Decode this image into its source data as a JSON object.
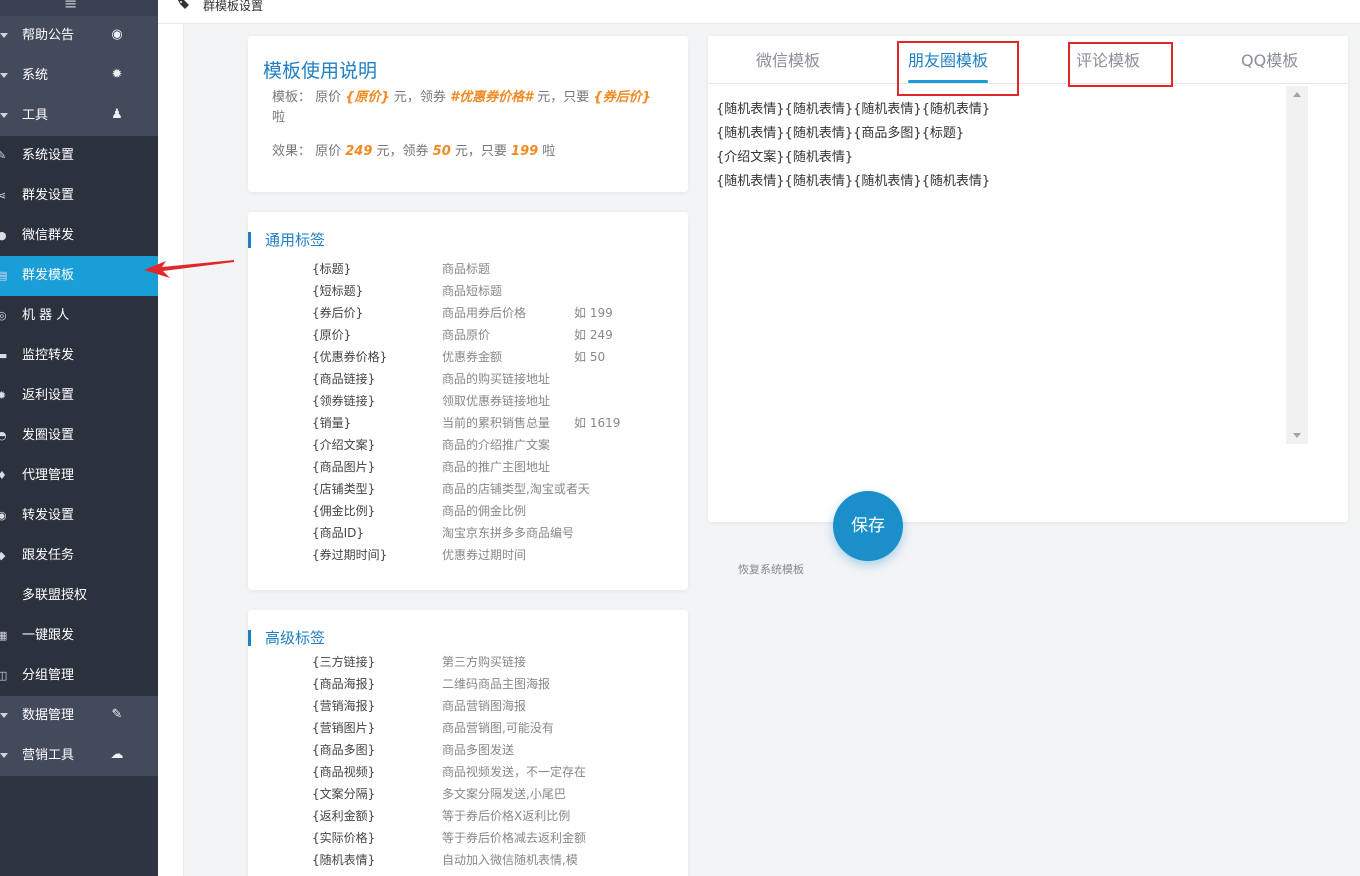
{
  "breadcrumb": {
    "title": "群模板设置"
  },
  "sidebar": {
    "items": [
      {
        "label": "帮助公告",
        "type": "header",
        "icon": "dashboard-icon"
      },
      {
        "label": "系统",
        "type": "header",
        "icon": "gear-icon"
      },
      {
        "label": "工具",
        "type": "header",
        "icon": "android-icon"
      },
      {
        "label": "系统设置",
        "type": "sub"
      },
      {
        "label": "群发设置",
        "type": "sub"
      },
      {
        "label": "微信群发",
        "type": "sub"
      },
      {
        "label": "群发模板",
        "type": "active"
      },
      {
        "label": "机 器 人",
        "type": "sub"
      },
      {
        "label": "监控转发",
        "type": "sub"
      },
      {
        "label": "返利设置",
        "type": "sub"
      },
      {
        "label": "发圈设置",
        "type": "sub"
      },
      {
        "label": "代理管理",
        "type": "sub"
      },
      {
        "label": "转发设置",
        "type": "sub"
      },
      {
        "label": "跟发任务",
        "type": "sub"
      },
      {
        "label": "多联盟授权",
        "type": "sub"
      },
      {
        "label": "一键跟发",
        "type": "sub"
      },
      {
        "label": "分组管理",
        "type": "sub"
      },
      {
        "label": "数据管理",
        "type": "header",
        "icon": "edit-icon"
      },
      {
        "label": "营销工具",
        "type": "header",
        "icon": "cloud-icon"
      }
    ]
  },
  "usage": {
    "title": "模板使用说明",
    "template_prefix": "模板：  原价 ",
    "t_origin": "{原价}",
    "t_mid1": " 元，领券 ",
    "t_coupon": "#优惠券价格#",
    "t_mid2": " 元，只要 ",
    "t_after": "{券后价}",
    "t_suffix": "啦",
    "effect_prefix": "效果：  原价 ",
    "e_origin": "249",
    "e_mid1": " 元，领券 ",
    "e_coupon": "50",
    "e_mid2": " 元，只要 ",
    "e_after": "199",
    "e_suffix": " 啦"
  },
  "common_tags": {
    "title": "通用标签",
    "rows": [
      {
        "key": "{标题}",
        "desc": "商品标题",
        "example": ""
      },
      {
        "key": "{短标题}",
        "desc": "商品短标题",
        "example": ""
      },
      {
        "key": "{券后价}",
        "desc": "商品用券后价格",
        "example": "如 199"
      },
      {
        "key": "{原价}",
        "desc": "商品原价",
        "example": "如 249"
      },
      {
        "key": "{优惠券价格}",
        "desc": "优惠券金额",
        "example": "如 50"
      },
      {
        "key": "{商品链接}",
        "desc": "商品的购买链接地址",
        "example": ""
      },
      {
        "key": "{领券链接}",
        "desc": "领取优惠券链接地址",
        "example": ""
      },
      {
        "key": "{销量}",
        "desc": "当前的累积销售总量",
        "example": "如 1619"
      },
      {
        "key": "{介绍文案}",
        "desc": "商品的介绍推广文案",
        "example": ""
      },
      {
        "key": "{商品图片}",
        "desc": "商品的推广主图地址",
        "example": ""
      },
      {
        "key": "{店铺类型}",
        "desc": "商品的店铺类型,淘宝或者天",
        "example": ""
      },
      {
        "key": "{佣金比例}",
        "desc": "商品的佣金比例",
        "example": ""
      },
      {
        "key": "{商品ID}",
        "desc": "淘宝京东拼多多商品编号",
        "example": ""
      },
      {
        "key": "{券过期时间}",
        "desc": "优惠券过期时间",
        "example": ""
      }
    ]
  },
  "advanced_tags": {
    "title": "高级标签",
    "rows": [
      {
        "key": "{三方链接}",
        "desc": "第三方购买链接"
      },
      {
        "key": "{商品海报}",
        "desc": "二维码商品主图海报"
      },
      {
        "key": "{营销海报}",
        "desc": "商品营销图海报"
      },
      {
        "key": "{营销图片}",
        "desc": "商品营销图,可能没有"
      },
      {
        "key": "{商品多图}",
        "desc": "商品多图发送"
      },
      {
        "key": "{商品视频}",
        "desc": "商品视频发送，不一定存在"
      },
      {
        "key": "{文案分隔}",
        "desc": "多文案分隔发送,小尾巴"
      },
      {
        "key": "{返利金额}",
        "desc": "等于券后价格X返利比例"
      },
      {
        "key": "{实际价格}",
        "desc": "等于券后价格减去返利金额"
      },
      {
        "key": "{随机表情}",
        "desc": "自动加入微信随机表情,模"
      }
    ]
  },
  "editor": {
    "tabs": [
      {
        "label": "微信模板"
      },
      {
        "label": "朋友圈模板"
      },
      {
        "label": "评论模板"
      },
      {
        "label": "QQ模板"
      }
    ],
    "active_tab": "朋友圈模板",
    "content_lines": [
      "{随机表情}{随机表情}{随机表情}{随机表情}",
      "{随机表情}{随机表情}{商品多图}{标题}",
      "{介绍文案}{随机表情}",
      "{随机表情}{随机表情}{随机表情}{随机表情}"
    ]
  },
  "actions": {
    "save": "保存",
    "restore": "恢复系统模板"
  },
  "colors": {
    "accent": "#1a9ed8",
    "sidebar": "#2f3542",
    "highlight": "#f08a24",
    "annotation": "#e0282a"
  }
}
